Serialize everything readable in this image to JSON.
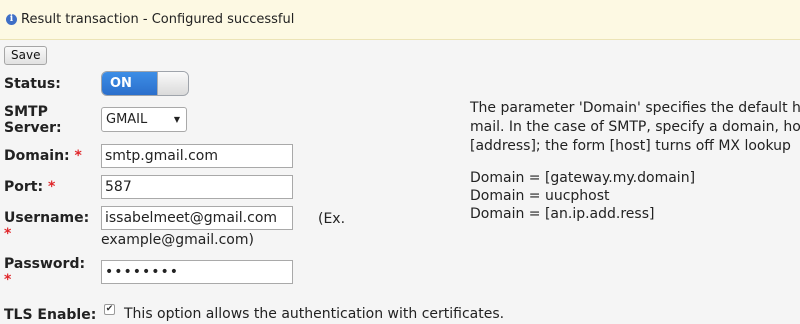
{
  "notice": {
    "icon": "info-icon",
    "text": "Result transaction - Configured successful"
  },
  "toolbar": {
    "save_label": "Save"
  },
  "form": {
    "status": {
      "label": "Status:",
      "value": "ON",
      "enabled": true
    },
    "smtp_server": {
      "label_line1": "SMTP",
      "label_line2": "Server:",
      "selected": "GMAIL"
    },
    "domain": {
      "label": "Domain:",
      "required_mark": "*",
      "value": "smtp.gmail.com"
    },
    "port": {
      "label": "Port:",
      "required_mark": "*",
      "value": "587"
    },
    "username": {
      "label": "Username:",
      "required_mark": "*",
      "value": "issabelmeet@gmail.com",
      "hint_line1": "(Ex.",
      "hint_line2": "example@gmail.com)"
    },
    "password": {
      "label": "Password:",
      "required_mark": "*",
      "value": "••••••••"
    },
    "tls": {
      "label": "TLS Enable:",
      "checked": true,
      "description": "This option allows the authentication with certificates."
    }
  },
  "help": {
    "lines": [
      "The parameter 'Domain' specifies the default h",
      "mail. In the case of SMTP, specify a domain, ho",
      "[address]; the form [host] turns off MX lookup"
    ],
    "examples": [
      "Domain = [gateway.my.domain]",
      "Domain = uucphost",
      "Domain = [an.ip.add.ress]"
    ]
  },
  "colors": {
    "notice_bg": "#fdf9e3",
    "toggle_on": "#2f7bd9",
    "required": "#e0262a",
    "info_icon": "#3f6fc6"
  }
}
